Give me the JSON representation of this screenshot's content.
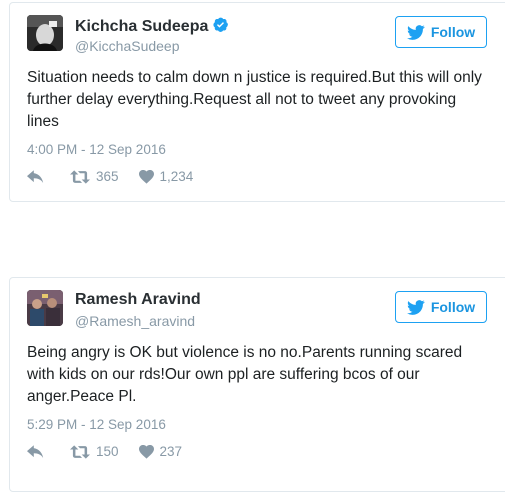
{
  "colors": {
    "accent": "#1da1f2",
    "text": "#1c2022",
    "muted": "#8899a6",
    "border": "#e1e8ed"
  },
  "tweets": [
    {
      "author_name": "Kichcha Sudeepa",
      "verified": true,
      "handle": "@KicchaSudeep",
      "follow_label": "Follow",
      "text": "Situation needs to calm down n justice is required.But this will only further delay everything.Request all not to tweet any provoking lines",
      "timestamp": "4:00 PM - 12 Sep 2016",
      "retweets": "365",
      "likes": "1,234",
      "icons": [
        "avatar",
        "verified-badge-icon",
        "twitter-bird-icon",
        "reply-icon",
        "retweet-icon",
        "heart-icon"
      ]
    },
    {
      "author_name": "Ramesh Aravind",
      "verified": false,
      "handle": "@Ramesh_aravind",
      "follow_label": "Follow",
      "text": "Being angry is OK but violence is no no.Parents running scared with kids on our rds!Our own ppl are suffering bcos of our anger.Peace Pl.",
      "timestamp": "5:29 PM - 12 Sep 2016",
      "retweets": "150",
      "likes": "237",
      "icons": [
        "avatar",
        "twitter-bird-icon",
        "reply-icon",
        "retweet-icon",
        "heart-icon"
      ]
    }
  ]
}
